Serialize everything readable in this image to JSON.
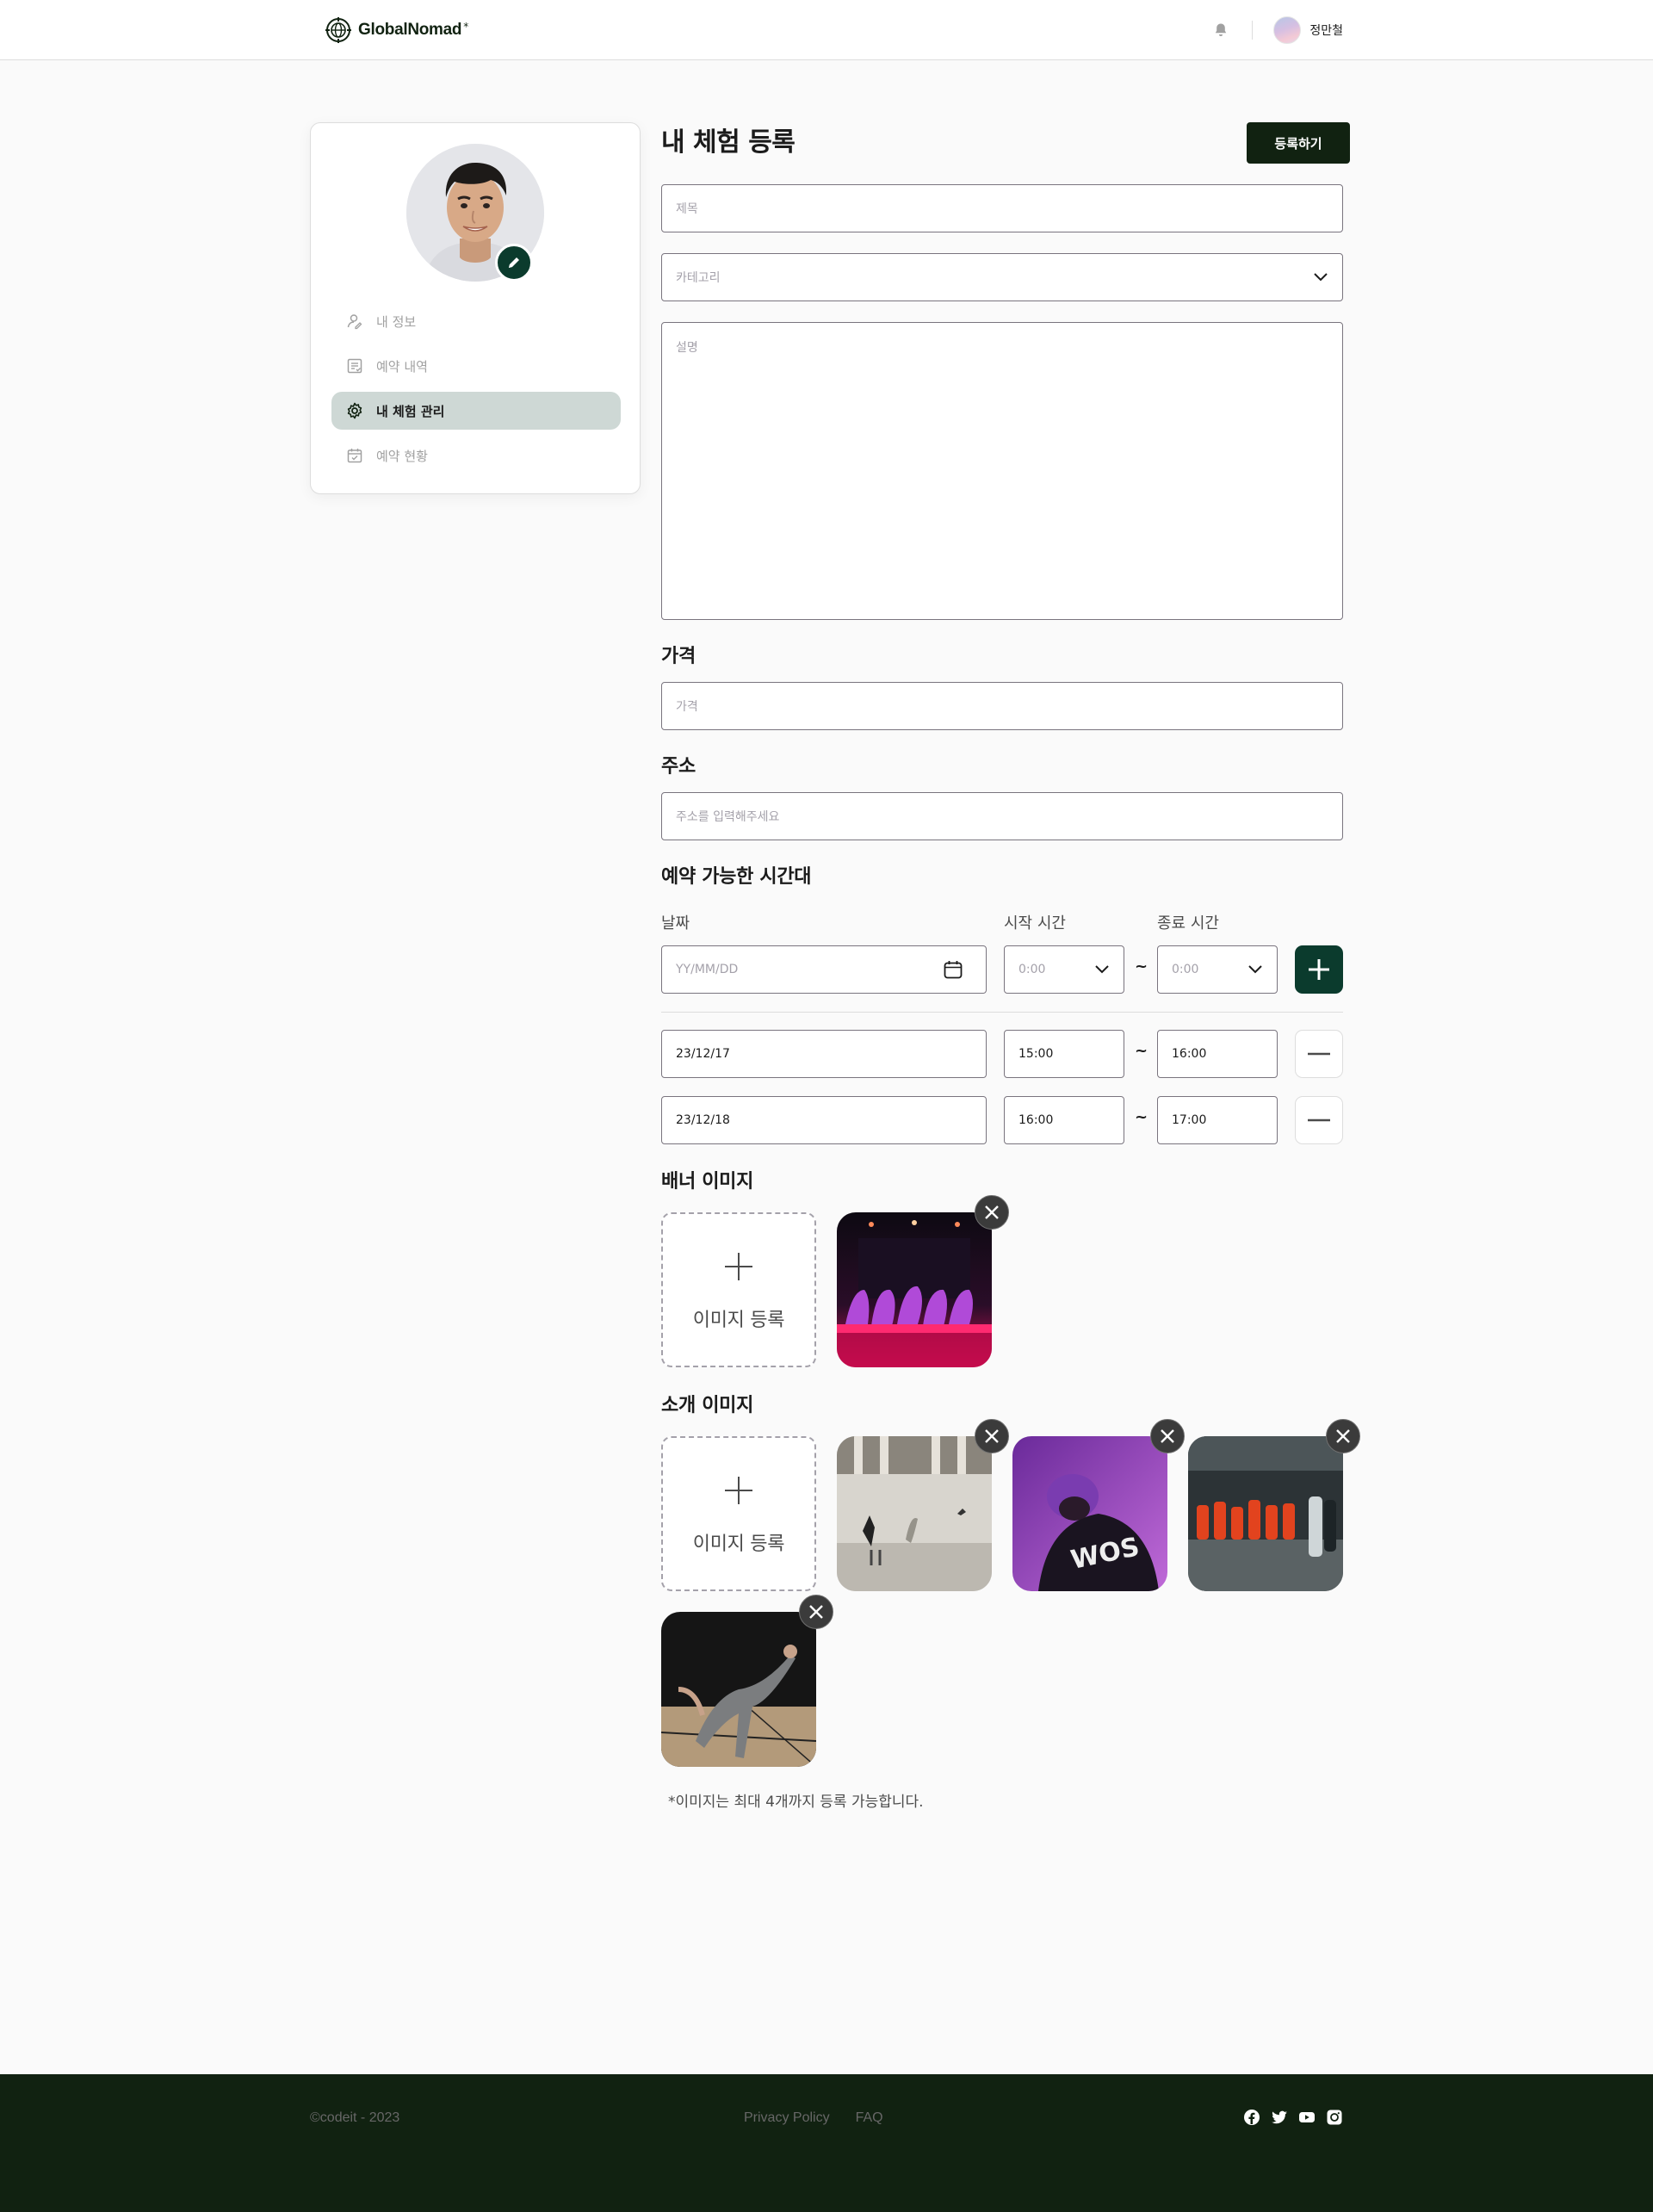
{
  "header": {
    "logo_text": "GlobalNomad",
    "user_name": "정만철",
    "icons": [
      "globe-logo-icon",
      "bell-icon",
      "avatar"
    ]
  },
  "sidebar": {
    "items": [
      {
        "label": "내 정보",
        "icon": "user-icon",
        "active": false
      },
      {
        "label": "예약 내역",
        "icon": "list-check-icon",
        "active": false
      },
      {
        "label": "내 체험 관리",
        "icon": "gear-icon",
        "active": true
      },
      {
        "label": "예약 현황",
        "icon": "calendar-check-icon",
        "active": false
      }
    ]
  },
  "main": {
    "title": "내 체험 등록",
    "submit_label": "등록하기",
    "title_placeholder": "제목",
    "category_placeholder": "카테고리",
    "description_placeholder": "설명",
    "price_heading": "가격",
    "price_placeholder": "가격",
    "address_heading": "주소",
    "address_placeholder": "주소를 입력해주세요",
    "schedule": {
      "heading": "예약 가능한 시간대",
      "date_label": "날짜",
      "start_label": "시작 시간",
      "end_label": "종료 시간",
      "date_placeholder": "YY/MM/DD",
      "start_placeholder": "0:00",
      "end_placeholder": "0:00",
      "separator": "~",
      "rows": [
        {
          "date": "23/12/17",
          "start": "15:00",
          "end": "16:00"
        },
        {
          "date": "23/12/18",
          "start": "16:00",
          "end": "17:00"
        }
      ]
    },
    "banner_heading": "배너 이미지",
    "intro_heading": "소개 이미지",
    "upload_label": "이미지 등록",
    "note": "*이미지는 최대 4개까지 등록 가능합니다."
  },
  "footer": {
    "copyright": "©codeit - 2023",
    "links": [
      "Privacy Policy",
      "FAQ"
    ],
    "socials": [
      "facebook-icon",
      "twitter-icon",
      "youtube-icon",
      "instagram-icon"
    ]
  },
  "colors": {
    "primary": "#0b3b2d",
    "dark": "#112211",
    "active_menu_bg": "#ced8d5",
    "border": "#79747e"
  }
}
